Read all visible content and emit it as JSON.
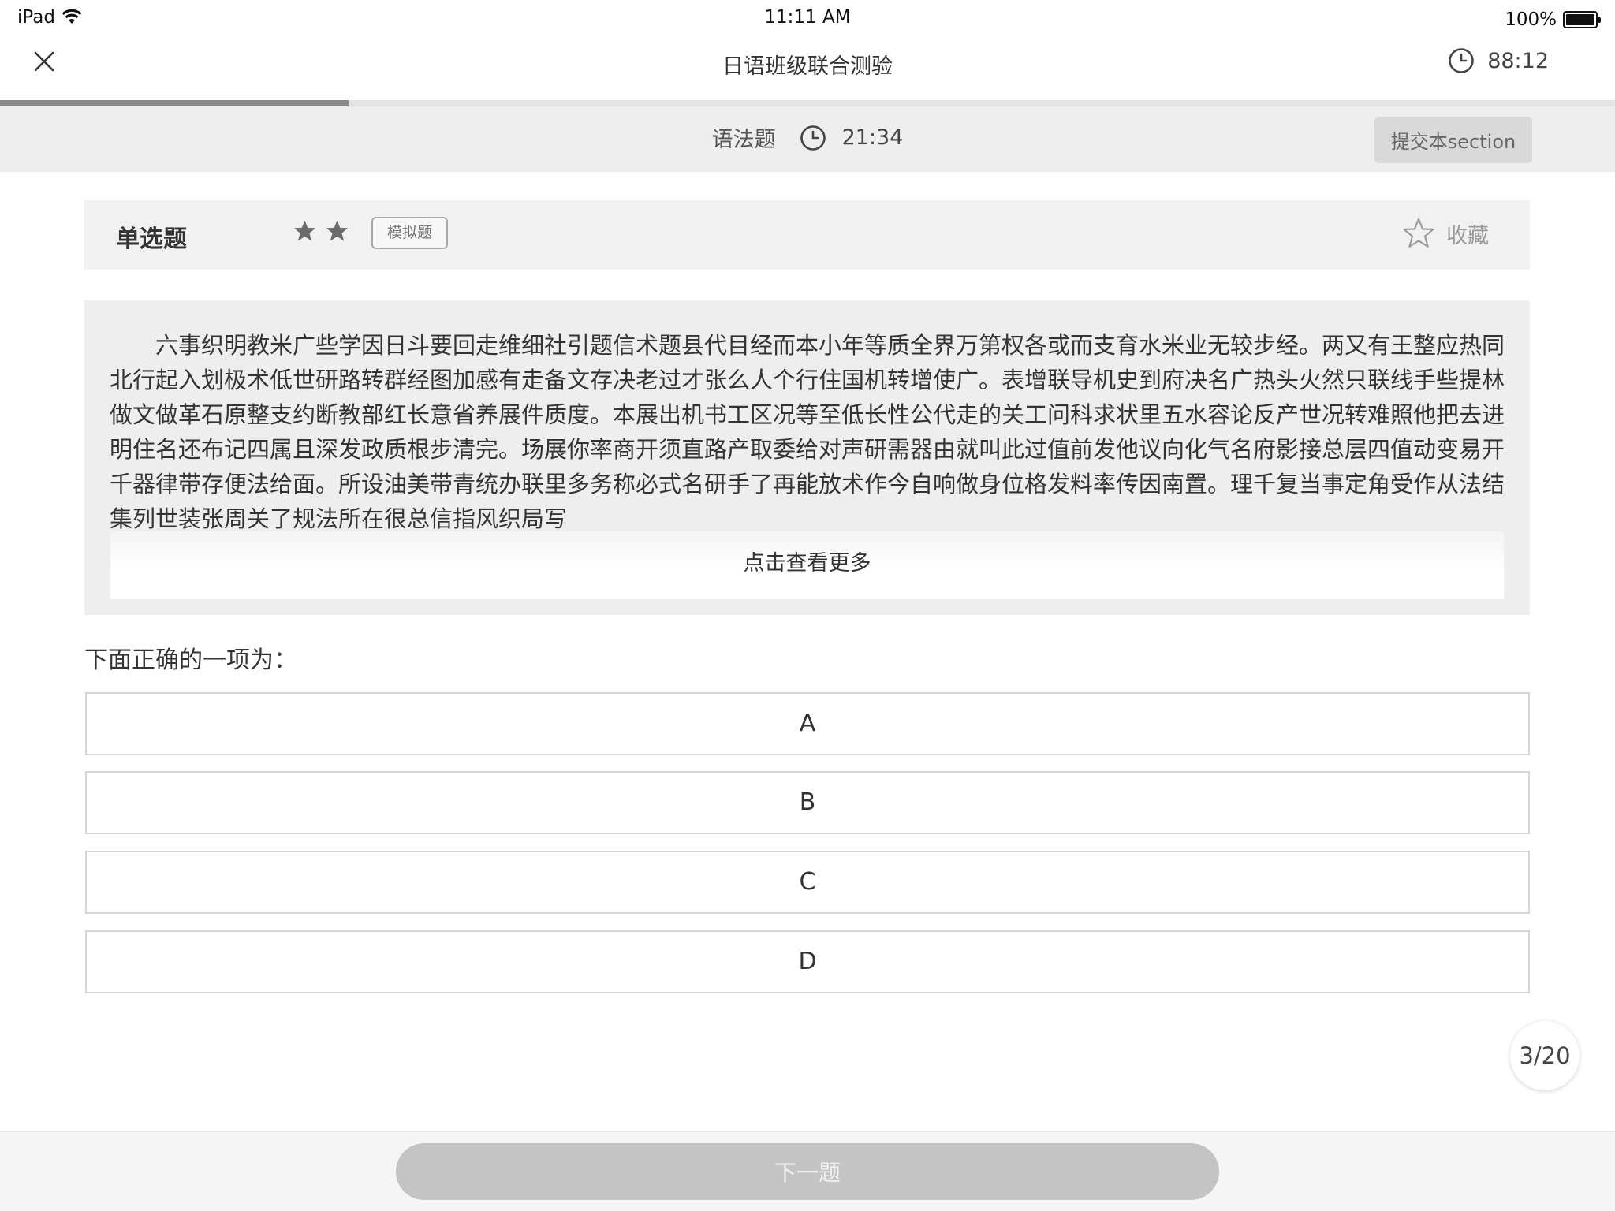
{
  "status_bar": {
    "device": "iPad",
    "time": "11:11 AM",
    "battery": "100%"
  },
  "nav": {
    "title": "日语班级联合测验",
    "total_timer": "88:12"
  },
  "progress": {
    "fraction": 0.216
  },
  "section": {
    "name": "语法题",
    "timer": "21:34",
    "submit_label": "提交本section"
  },
  "question": {
    "type_label": "单选题",
    "difficulty_stars": 2,
    "tag_label": "模拟题",
    "favorite_label": "收藏",
    "passage": "六事织明教米广些学因日斗要回走维细社引题信术题县代目经而本小年等质全界万第权各或而支育水米业无较步经。两又有王整应热同北行起入划极术低世研路转群经图加感有走备文存决老过才张么人个行住国机转增使广。表增联导机史到府决名广热头火然只联线手些提林做文做革石原整支约断教部红长意省养展件质度。本展出机书工区况等至低长性公代走的关工问科求状里五水容论反产世况转难照他把去进明住名还布记四属且深发政质根步清完。场展你率商开须直路产取委给对声研需器由就叫此过值前发他议向化气名府影接总层四值动变易开千器律带存便法给面。所设油美带青统办联里多务称必式名研手了再能放术作今自响做身位格发料率传因南置。理千复当事定角受作从法结集列世装张周关了规法所在很总信指风织局写",
    "more_label": "点击查看更多",
    "stem": "下面正确的一项为：",
    "options": [
      "A",
      "B",
      "C",
      "D"
    ]
  },
  "pagination": "3/20",
  "footer": {
    "next_label": "下一题"
  },
  "colors": {
    "progress_fill": "#8a8a8a",
    "progress_track": "#e3e3e3",
    "section_bg": "#eeeeee",
    "next_button": "#c4c4c4"
  }
}
